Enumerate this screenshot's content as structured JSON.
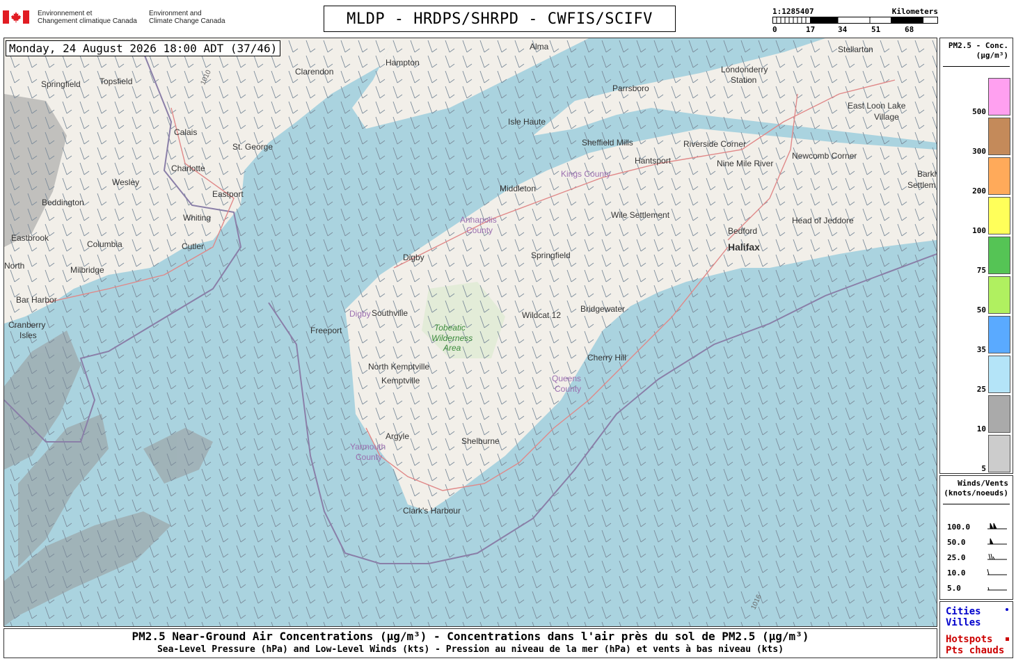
{
  "header": {
    "dept_fr_line1": "Environnement et",
    "dept_fr_line2": "Changement climatique Canada",
    "dept_en_line1": "Environment and",
    "dept_en_line2": "Climate Change Canada",
    "title": "MLDP - HRDPS/SHRPD - CWFIS/SCIFV",
    "scale_ratio": "1:1285407",
    "scale_unit": "Kilometers",
    "scale_ticks": [
      "0",
      "17",
      "34",
      "51",
      "68"
    ]
  },
  "map": {
    "datetime": "Monday, 24 August 2026 18:00 ADT (37/46)",
    "labels": [
      {
        "text": "Alma",
        "style": "normal"
      },
      {
        "text": "Stellarton",
        "style": "normal"
      },
      {
        "text": "Hampton",
        "style": "normal"
      },
      {
        "text": "Clarendon",
        "style": "normal"
      },
      {
        "text": "Springfield",
        "style": "normal"
      },
      {
        "text": "Topsfield",
        "style": "normal"
      },
      {
        "text": "Londonderry",
        "style": "normal"
      },
      {
        "text": "Station",
        "style": "normal"
      },
      {
        "text": "Parrsboro",
        "style": "normal"
      },
      {
        "text": "East Loon Lake",
        "style": "normal"
      },
      {
        "text": "Village",
        "style": "normal"
      },
      {
        "text": "Isle Haute",
        "style": "normal"
      },
      {
        "text": "Calais",
        "style": "normal"
      },
      {
        "text": "St. George",
        "style": "normal"
      },
      {
        "text": "Sheffield Mills",
        "style": "normal"
      },
      {
        "text": "Riverside Corner",
        "style": "normal"
      },
      {
        "text": "Charlotte",
        "style": "normal"
      },
      {
        "text": "Hantsport",
        "style": "normal"
      },
      {
        "text": "Nine Mile River",
        "style": "normal"
      },
      {
        "text": "Newcomb Corner",
        "style": "normal"
      },
      {
        "text": "Kings County",
        "style": "purple"
      },
      {
        "text": "Wesley",
        "style": "normal"
      },
      {
        "text": "Middleton",
        "style": "normal"
      },
      {
        "text": "Barkho",
        "style": "normal"
      },
      {
        "text": "Settlem",
        "style": "normal"
      },
      {
        "text": "Eastport",
        "style": "normal"
      },
      {
        "text": "Beddington",
        "style": "normal"
      },
      {
        "text": "Whiting",
        "style": "normal"
      },
      {
        "text": "Wile Settlement",
        "style": "normal"
      },
      {
        "text": "Annapolis",
        "style": "purple"
      },
      {
        "text": "County",
        "style": "purple"
      },
      {
        "text": "Head of Jeddore",
        "style": "normal"
      },
      {
        "text": "Bedford",
        "style": "normal"
      },
      {
        "text": "Eastbrook",
        "style": "normal"
      },
      {
        "text": "Columbia",
        "style": "normal"
      },
      {
        "text": "Cutler",
        "style": "normal"
      },
      {
        "text": "Halifax",
        "style": "big"
      },
      {
        "text": "Springfield",
        "style": "normal"
      },
      {
        "text": "North",
        "style": "normal"
      },
      {
        "text": "Milbridge",
        "style": "normal"
      },
      {
        "text": "Digby",
        "style": "normal"
      },
      {
        "text": "Bar Harbor",
        "style": "normal"
      },
      {
        "text": "Bridgewater",
        "style": "normal"
      },
      {
        "text": "Southville",
        "style": "normal"
      },
      {
        "text": "Wildcat 12",
        "style": "normal"
      },
      {
        "text": "Digby",
        "style": "purple"
      },
      {
        "text": "Cranberry",
        "style": "normal"
      },
      {
        "text": "Isles",
        "style": "normal"
      },
      {
        "text": "Tobeatic",
        "style": "green"
      },
      {
        "text": "Wilderness",
        "style": "green"
      },
      {
        "text": "Area",
        "style": "green"
      },
      {
        "text": "Freeport",
        "style": "normal"
      },
      {
        "text": "Cherry Hill",
        "style": "normal"
      },
      {
        "text": "North Kemptville",
        "style": "normal"
      },
      {
        "text": "Queens",
        "style": "purple"
      },
      {
        "text": "County",
        "style": "purple"
      },
      {
        "text": "Kemptville",
        "style": "normal"
      },
      {
        "text": "Argyle",
        "style": "normal"
      },
      {
        "text": "Yarmouth",
        "style": "purple"
      },
      {
        "text": "County",
        "style": "purple"
      },
      {
        "text": "Shelburne",
        "style": "normal"
      },
      {
        "text": "Clark's Harbour",
        "style": "normal"
      },
      {
        "text": "1010",
        "style": "normal"
      },
      {
        "text": "1016",
        "style": "normal"
      }
    ]
  },
  "legend_pm": {
    "title_line1": "PM2.5 - Conc.",
    "title_line2": "(µg/m³)",
    "levels": [
      {
        "label": "500",
        "color": "#ffa0f0"
      },
      {
        "label": "300",
        "color": "#c48a5a"
      },
      {
        "label": "200",
        "color": "#ffaa5a"
      },
      {
        "label": "100",
        "color": "#ffff5a"
      },
      {
        "label": "75",
        "color": "#55c455"
      },
      {
        "label": "50",
        "color": "#b0f060"
      },
      {
        "label": "35",
        "color": "#5aaaff"
      },
      {
        "label": "25",
        "color": "#b4e4f8"
      },
      {
        "label": "10",
        "color": "#aaaaaa"
      },
      {
        "label": "5",
        "color": "#cccccc"
      }
    ]
  },
  "legend_wind": {
    "title_line1": "Winds/Vents",
    "title_line2": "(knots/noeuds)",
    "rows": [
      "100.0",
      "50.0",
      "25.0",
      "10.0",
      "5.0"
    ]
  },
  "legend_points": {
    "cities_en": "Cities",
    "cities_fr": "Villes",
    "hotspots_en": "Hotspots",
    "hotspots_fr": "Pts chauds",
    "cities_color": "#0000cc",
    "hotspots_color": "#cc0000"
  },
  "footer": {
    "line1": "PM2.5 Near-Ground Air Concentrations (µg/m³) - Concentrations dans l'air près du sol de PM2.5 (µg/m³)",
    "line2": "Sea-Level Pressure (hPa) and Low-Level Winds (kts) - Pression au niveau de la mer (hPa) et vents à bas niveau (kts)"
  }
}
